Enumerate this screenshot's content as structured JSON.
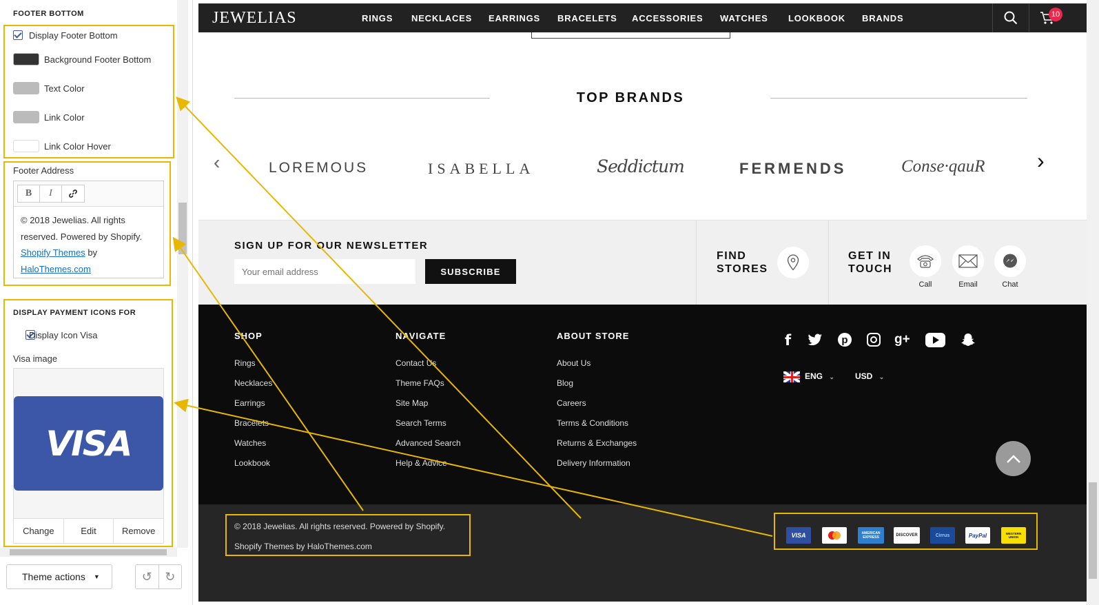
{
  "editor": {
    "footer_bottom": {
      "title": "FOOTER BOTTOM",
      "display_label": "Display Footer Bottom",
      "bg_label": "Background Footer Bottom",
      "text_color_label": "Text Color",
      "link_color_label": "Link Color",
      "link_hover_label": "Link Color Hover",
      "colors": {
        "bg": "#333333",
        "text": "#bbbbbb",
        "link": "#bbbbbb",
        "link_hover": "#ffffff"
      }
    },
    "footer_address": {
      "label": "Footer Address",
      "toolbar": {
        "bold": "B",
        "italic": "I"
      },
      "text1": "© 2018 Jewelias. All rights reserved. Powered by Shopify.",
      "link1": "Shopify Themes",
      "text2": " by",
      "link2": "HaloThemes.com"
    },
    "payment": {
      "title": "DISPLAY PAYMENT ICONS FOR",
      "visa_label": "Display Icon Visa",
      "visa_image_label": "Visa image",
      "visa_text": "VISA",
      "buttons": [
        "Change",
        "Edit",
        "Remove"
      ]
    },
    "theme_actions": "Theme actions"
  },
  "store": {
    "logo": "JEWELIAS",
    "nav": [
      "RINGS",
      "NECKLACES",
      "EARRINGS",
      "BRACELETS",
      "ACCESSORIES",
      "WATCHES",
      "LOOKBOOK",
      "BRANDS"
    ],
    "cart_count": "10",
    "top_brands": "TOP BRANDS",
    "brands": [
      "LOREMOUS",
      "ISABELLA",
      "Seddictum",
      "FERMENDS",
      "Conse·qauR"
    ],
    "newsletter": {
      "title": "SIGN UP FOR OUR NEWSLETTER",
      "placeholder": "Your email address",
      "button": "SUBSCRIBE"
    },
    "find_stores": [
      "FIND",
      "STORES"
    ],
    "get_in_touch": [
      "GET IN",
      "TOUCH"
    ],
    "contact": [
      "Call",
      "Email",
      "Chat"
    ],
    "footer": {
      "shop": {
        "title": "SHOP",
        "links": [
          "Rings",
          "Necklaces",
          "Earrings",
          "Bracelets",
          "Watches",
          "Lookbook"
        ]
      },
      "navigate": {
        "title": "NAVIGATE",
        "links": [
          "Contact Us",
          "Theme FAQs",
          "Site Map",
          "Search Terms",
          "Advanced Search",
          "Help & Advice"
        ]
      },
      "about": {
        "title": "ABOUT STORE",
        "links": [
          "About Us",
          "Blog",
          "Careers",
          "Terms & Conditions",
          "Returns & Exchanges",
          "Delivery Information"
        ]
      },
      "language": "ENG",
      "currency": "USD"
    },
    "bottom": {
      "line1": "© 2018 Jewelias. All rights reserved. Powered by Shopify.",
      "line2": "Shopify Themes by HaloThemes.com"
    },
    "payments": [
      "VISA",
      "MC",
      "AMERICAN EXPRESS",
      "DISCOVER",
      "Cirrus",
      "PayPal",
      "WESTERN UNION"
    ]
  }
}
